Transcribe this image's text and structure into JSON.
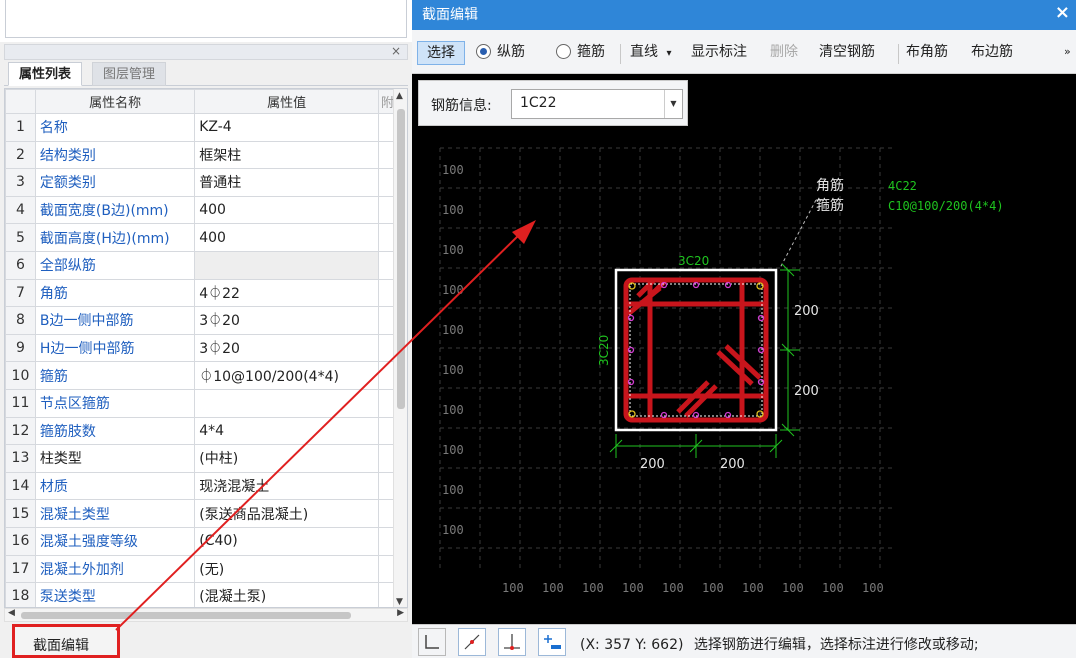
{
  "left_panel": {
    "close_glyph": "×",
    "tabs": [
      "属性列表",
      "图层管理"
    ],
    "table": {
      "headers": [
        "属性名称",
        "属性值",
        "附"
      ],
      "rows": [
        {
          "idx": "1",
          "name": "名称",
          "value": "KZ-4",
          "name_color": "blue"
        },
        {
          "idx": "2",
          "name": "结构类别",
          "value": "框架柱",
          "name_color": "blue"
        },
        {
          "idx": "3",
          "name": "定额类别",
          "value": "普通柱",
          "name_color": "blue"
        },
        {
          "idx": "4",
          "name": "截面宽度(B边)(mm)",
          "value": "400",
          "name_color": "blue"
        },
        {
          "idx": "5",
          "name": "截面高度(H边)(mm)",
          "value": "400",
          "name_color": "blue"
        },
        {
          "idx": "6",
          "name": "全部纵筋",
          "value": "",
          "name_color": "blue"
        },
        {
          "idx": "7",
          "name": "角筋",
          "value": "4⏀22",
          "name_color": "blue"
        },
        {
          "idx": "8",
          "name": "B边一侧中部筋",
          "value": "3⏀20",
          "name_color": "blue"
        },
        {
          "idx": "9",
          "name": "H边一侧中部筋",
          "value": "3⏀20",
          "name_color": "blue"
        },
        {
          "idx": "10",
          "name": "箍筋",
          "value": "⏀10@100/200(4*4)",
          "name_color": "blue"
        },
        {
          "idx": "11",
          "name": "节点区箍筋",
          "value": "",
          "name_color": "blue"
        },
        {
          "idx": "12",
          "name": "箍筋肢数",
          "value": "4*4",
          "name_color": "blue"
        },
        {
          "idx": "13",
          "name": "柱类型",
          "value": "(中柱)",
          "name_color": "black"
        },
        {
          "idx": "14",
          "name": "材质",
          "value": "现浇混凝土",
          "name_color": "blue"
        },
        {
          "idx": "15",
          "name": "混凝土类型",
          "value": "(泵送商品混凝土)",
          "name_color": "blue"
        },
        {
          "idx": "16",
          "name": "混凝土强度等级",
          "value": "(C40)",
          "name_color": "blue"
        },
        {
          "idx": "17",
          "name": "混凝土外加剂",
          "value": "(无)",
          "name_color": "blue"
        },
        {
          "idx": "18",
          "name": "泵送类型",
          "value": "(混凝土泵)",
          "name_color": "blue"
        }
      ]
    },
    "bottom_tab": "截面编辑"
  },
  "window": {
    "title": "截面编辑",
    "close_glyph": "×",
    "toolbar": {
      "select": "选择",
      "radio_longitudinal": "纵筋",
      "radio_stirrup": "箍筋",
      "line": "直线",
      "line_dropdown": "▾",
      "show_dims": "显示标注",
      "delete": "删除",
      "clear": "清空钢筋",
      "corner_bar": "布角筋",
      "side_bar": "布边筋",
      "more": "»"
    },
    "rebar_info": {
      "label": "钢筋信息:",
      "value": "1C22",
      "dropdown": "▼"
    },
    "canvas": {
      "grid_label": "100",
      "corner_label": "角筋",
      "stirrup_label": "箍筋",
      "corner_spec": "4C22",
      "stirrup_spec": "C10@100/200(4*4)",
      "top_spec": "3C20",
      "left_spec": "3C20",
      "dim_right_top": "200",
      "dim_right_bottom": "200",
      "dim_bottom_left": "200",
      "dim_bottom_right": "200"
    },
    "status": {
      "coords": "(X: 357 Y: 662)",
      "message": "选择钢筋进行编辑，选择标注进行修改或移动;"
    }
  },
  "colors": {
    "title_blue": "#2f86d8",
    "rebar_red": "#c8151c",
    "dim_green": "#1fc41f",
    "annotation_red": "#e02020",
    "magenta_bar": "#d23cd2"
  }
}
